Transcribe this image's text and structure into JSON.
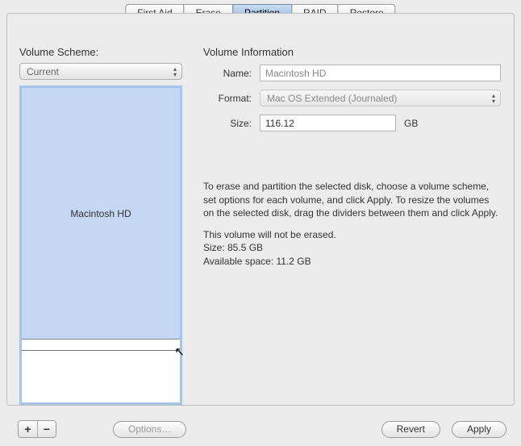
{
  "tabs": {
    "items": [
      "First Aid",
      "Erase",
      "Partition",
      "RAID",
      "Restore"
    ],
    "selected": 2
  },
  "left": {
    "title": "Volume Scheme:",
    "scheme_popup": "Current",
    "volume_name": "Macintosh HD"
  },
  "right": {
    "title": "Volume Information",
    "name_label": "Name:",
    "name_value": "Macintosh HD",
    "format_label": "Format:",
    "format_value": "Mac OS Extended (Journaled)",
    "size_label": "Size:",
    "size_value": "116.12",
    "size_unit": "GB",
    "help1": "To erase and partition the selected disk, choose a volume scheme, set options for each volume, and click Apply. To resize the volumes on the selected disk, drag the dividers between them and click Apply.",
    "help2": "This volume will not be erased.",
    "help3": "Size: 85.5 GB",
    "help4": "Available space: 11.2 GB"
  },
  "bottom": {
    "add": "+",
    "remove": "−",
    "options": "Options…",
    "revert": "Revert",
    "apply": "Apply"
  }
}
